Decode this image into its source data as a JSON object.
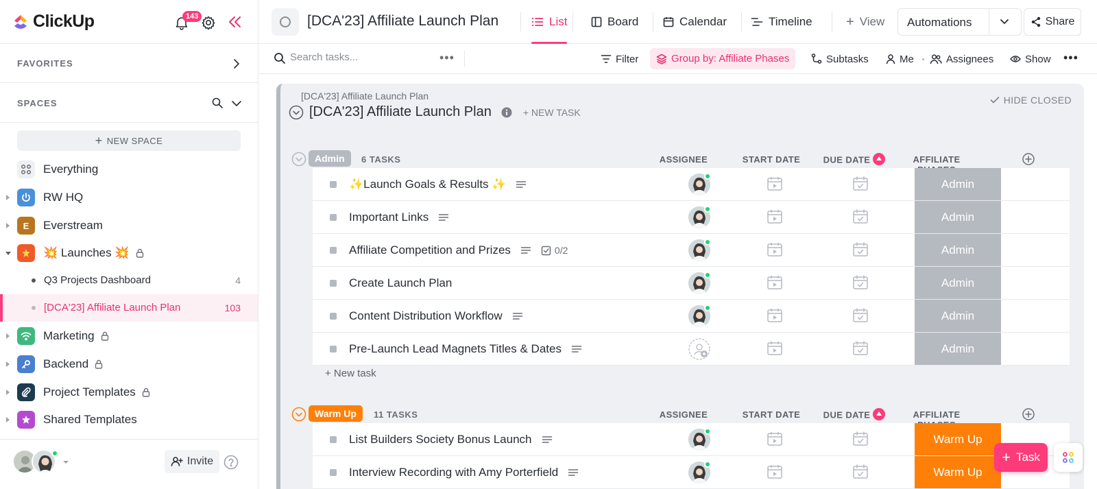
{
  "brand": {
    "name": "ClickUp",
    "accent": "#fd3b7a"
  },
  "header": {
    "notification_count": "143"
  },
  "sidebar": {
    "favorites_label": "FAVORITES",
    "spaces_label": "SPACES",
    "new_space_label": "NEW SPACE",
    "items": [
      {
        "label": "Everything",
        "icon": "grid-icon",
        "color": "#eef0f3"
      },
      {
        "label": "RW HQ",
        "icon": "power-icon",
        "color": "#4a90d9"
      },
      {
        "label": "Everstream",
        "icon_letter": "E",
        "color": "#b8761e"
      },
      {
        "label": "💥 Launches 💥",
        "icon": "burst-icon",
        "color": "#f05a28",
        "locked": true
      },
      {
        "label": "Marketing",
        "icon": "wifi-icon",
        "color": "#3fb87f",
        "locked": true
      },
      {
        "label": "Backend",
        "icon": "key-icon",
        "color": "#4a7fd0",
        "locked": true
      },
      {
        "label": "Project Templates",
        "icon": "paperclip-icon",
        "color": "#1b3b4f",
        "locked": true
      },
      {
        "label": "Shared Templates",
        "icon": "star-icon",
        "color": "#b54ad0"
      }
    ],
    "lists": [
      {
        "label": "Q3 Projects Dashboard",
        "count": "4"
      },
      {
        "label": "[DCA'23] Affiliate Launch Plan",
        "count": "103",
        "active": true
      }
    ],
    "invite_label": "Invite"
  },
  "topbar": {
    "list_title": "[DCA'23] Affiliate Launch Plan",
    "views": [
      "List",
      "Board",
      "Calendar",
      "Timeline"
    ],
    "add_view_label": "View",
    "automations_label": "Automations",
    "share_label": "Share"
  },
  "toolbar": {
    "search_placeholder": "Search tasks...",
    "filter_label": "Filter",
    "group_by_label": "Group by: Affiliate Phases",
    "subtasks_label": "Subtasks",
    "me_label": "Me",
    "assignees_label": "Assignees",
    "show_label": "Show"
  },
  "list": {
    "breadcrumb": "[DCA'23] Affiliate Launch Plan",
    "title": "[DCA'23] Affiliate Launch Plan",
    "new_task_label": "+ NEW TASK",
    "hide_closed_label": "HIDE CLOSED",
    "columns": [
      "ASSIGNEE",
      "START DATE",
      "DUE DATE",
      "AFFILIATE PHASES"
    ],
    "new_task_row_label": "+ New task",
    "groups": [
      {
        "name": "Admin",
        "count_label": "6 TASKS",
        "color": "#b5b9c0",
        "tasks": [
          {
            "name": "✨Launch Goals & Results ✨",
            "has_desc": true,
            "assigned": true
          },
          {
            "name": "Important Links",
            "has_desc": true,
            "assigned": true
          },
          {
            "name": "Affiliate Competition and Prizes",
            "has_desc": true,
            "checklist": "0/2",
            "assigned": true
          },
          {
            "name": "Create Launch Plan",
            "has_desc": false,
            "assigned": true
          },
          {
            "name": "Content Distribution Workflow",
            "has_desc": true,
            "assigned": true
          },
          {
            "name": "Pre-Launch Lead Magnets Titles & Dates",
            "has_desc": true,
            "assigned": false
          }
        ]
      },
      {
        "name": "Warm Up",
        "count_label": "11 TASKS",
        "color": "#fe8008",
        "tasks": [
          {
            "name": "List Builders Society Bonus Launch",
            "has_desc": true,
            "assigned": true
          },
          {
            "name": "Interview Recording with Amy Porterfield",
            "has_desc": true,
            "assigned": true
          }
        ]
      }
    ]
  },
  "fab": {
    "label": "Task"
  }
}
